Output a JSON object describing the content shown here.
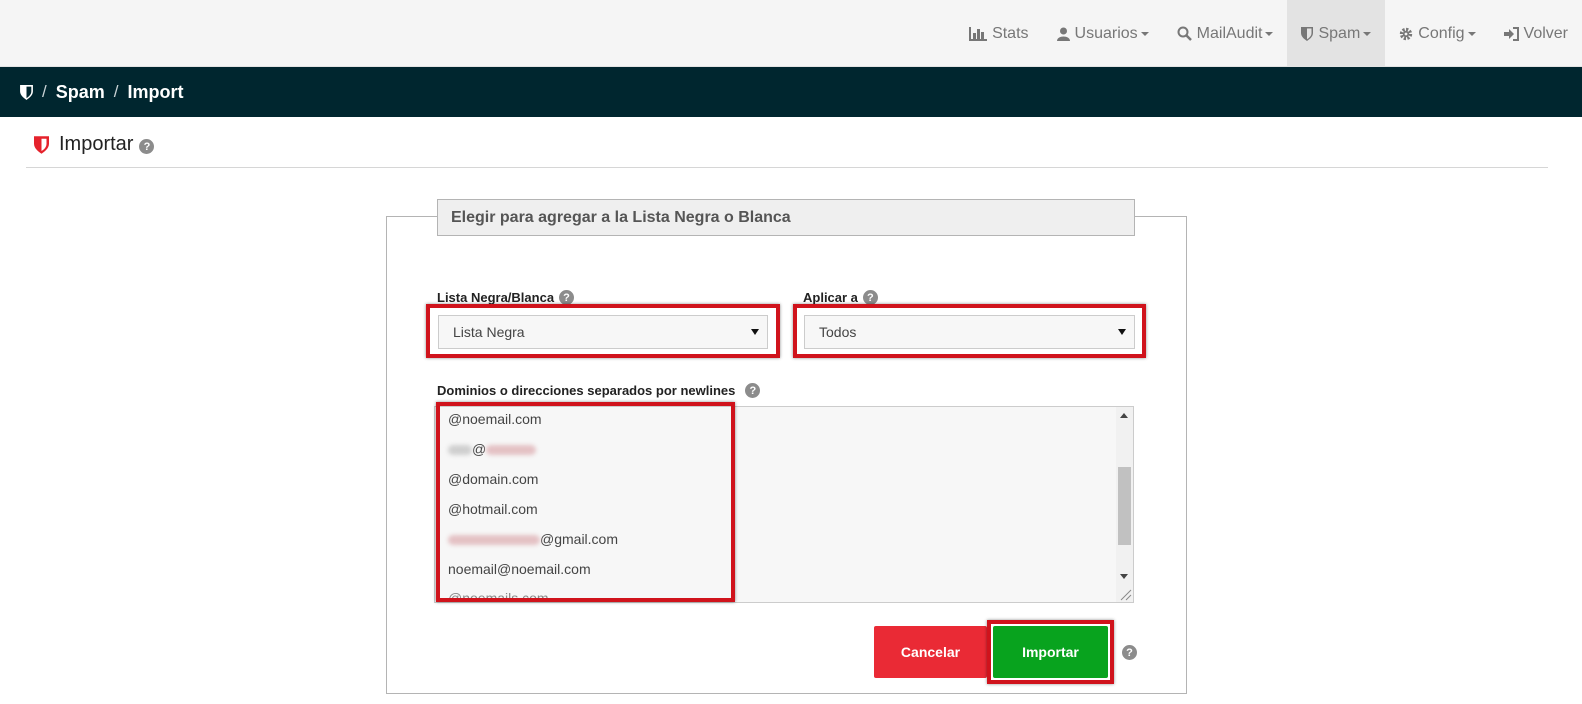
{
  "nav": {
    "items": [
      {
        "label": "Stats",
        "icon": "bar-chart-icon",
        "caret": false
      },
      {
        "label": "Usuarios",
        "icon": "user-icon",
        "caret": true
      },
      {
        "label": "MailAudit",
        "icon": "search-icon",
        "caret": true
      },
      {
        "label": "Spam",
        "icon": "shield-icon",
        "caret": true,
        "active": true
      },
      {
        "label": "Config",
        "icon": "gear-icon",
        "caret": true
      },
      {
        "label": "Volver",
        "icon": "sign-in-icon",
        "caret": false
      }
    ]
  },
  "breadcrumb": {
    "separator": "/",
    "items": [
      "Spam",
      "Import"
    ]
  },
  "page": {
    "title": "Importar",
    "help_glyph": "?"
  },
  "form": {
    "legend": "Elegir para agregar a la Lista Negra o Blanca",
    "list_label": "Lista Negra/Blanca",
    "list_value": "Lista Negra",
    "apply_label": "Aplicar a",
    "apply_value": "Todos",
    "textarea_label": "Dominios o direcciones separados por newlines",
    "lines": [
      "@noemail.com",
      "@",
      "@domain.com",
      "@hotmail.com",
      "@gmail.com",
      "noemail@noemail.com",
      "@noemails.com"
    ],
    "cancel_label": "Cancelar",
    "import_label": "Importar"
  },
  "colors": {
    "breadcrumb_bg": "#00262f",
    "highlight": "#d0131c",
    "cancel": "#ea2a35",
    "import": "#08a31e"
  }
}
